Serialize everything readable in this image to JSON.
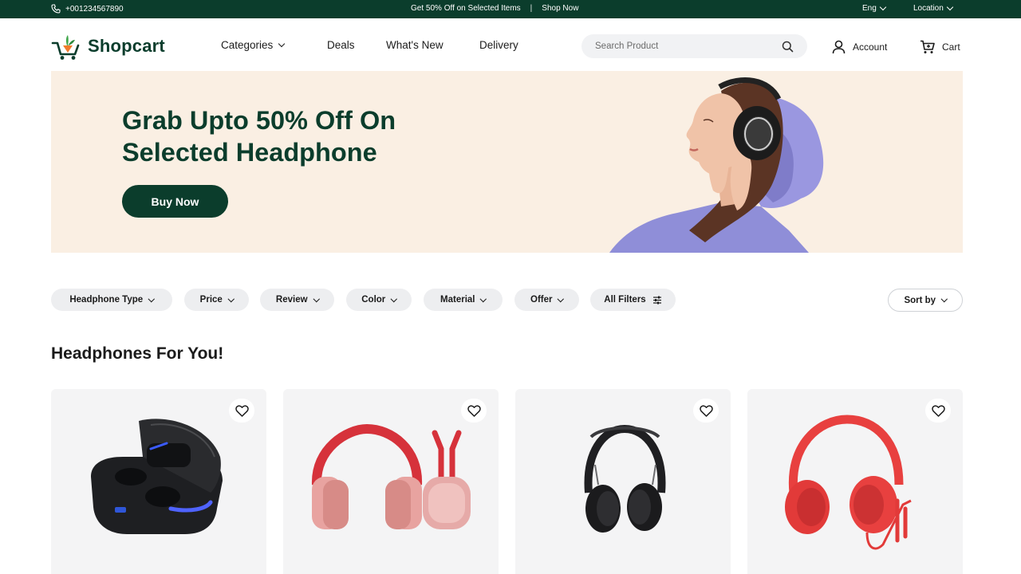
{
  "topbar": {
    "phone": "+001234567890",
    "promo": "Get 50% Off on Selected Items",
    "separator": "|",
    "shop_now": "Shop Now",
    "language": "Eng",
    "location": "Location"
  },
  "header": {
    "brand": "Shopcart",
    "nav": [
      "Categories",
      "Deals",
      "What's New",
      "Delivery"
    ],
    "search_placeholder": "Search Product",
    "account_label": "Account",
    "cart_label": "Cart"
  },
  "hero": {
    "headline_line1": "Grab Upto 50% Off On",
    "headline_line2": "Selected Headphone",
    "cta": "Buy Now"
  },
  "filters": {
    "chips": [
      "Headphone Type",
      "Price",
      "Review",
      "Color",
      "Material",
      "Offer",
      "All Filters"
    ],
    "sort_label": "Sort by"
  },
  "section": {
    "title": "Headphones For You!"
  },
  "products": [
    {
      "image": "wireless-earbuds-case",
      "icon": "heart-icon"
    },
    {
      "image": "pink-over-ear-headphones",
      "icon": "heart-icon"
    },
    {
      "image": "black-over-ear-headphones",
      "icon": "heart-icon"
    },
    {
      "image": "red-wired-headphones",
      "icon": "heart-icon"
    }
  ],
  "colors": {
    "brand_green": "#0b3d2c",
    "hero_bg": "#faefe3",
    "chip_bg": "#edeef0",
    "card_bg": "#f4f4f5"
  }
}
